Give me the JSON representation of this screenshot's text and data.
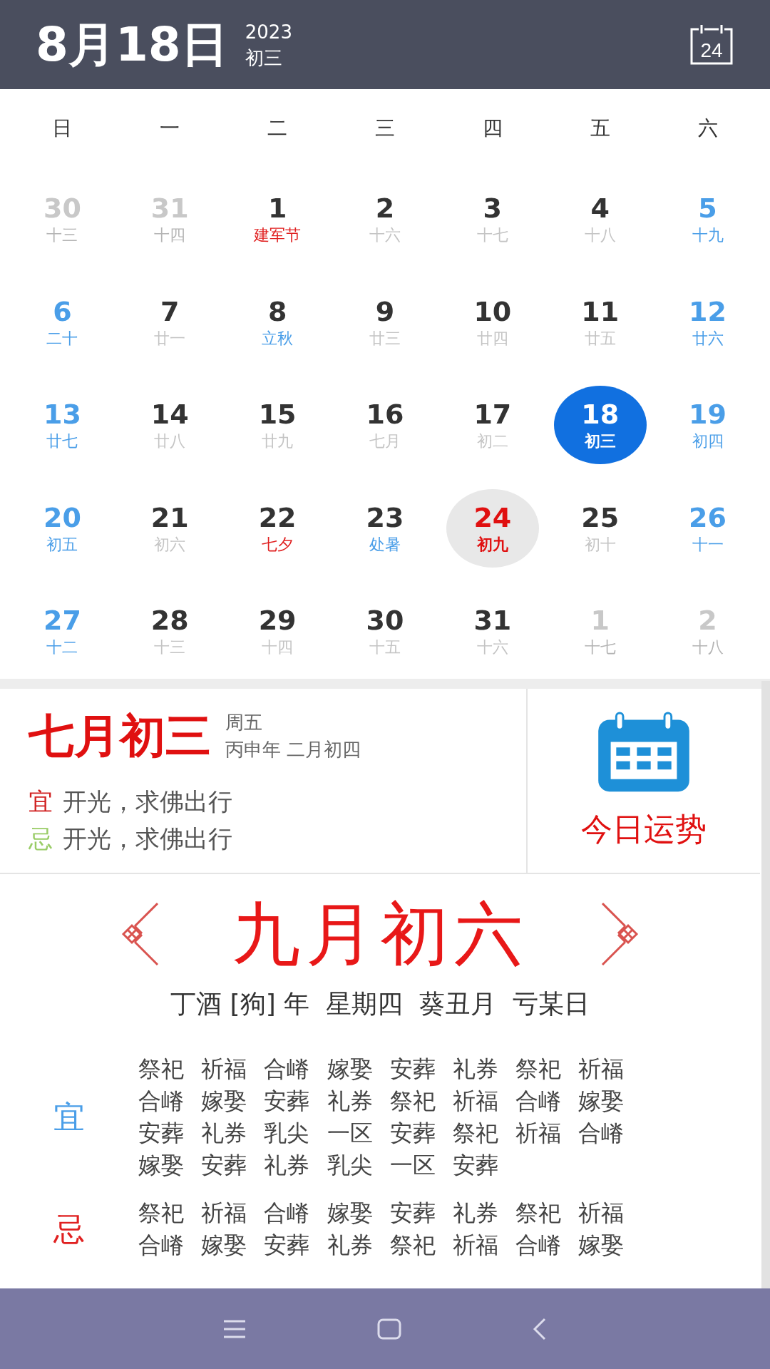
{
  "header": {
    "date": "8月18日",
    "year": "2023",
    "lunar": "初三",
    "today_button": "24"
  },
  "weekdays": [
    "日",
    "一",
    "二",
    "三",
    "四",
    "五",
    "六"
  ],
  "days": [
    {
      "day": "30",
      "lunar": {
        "text": "十三",
        "kind": "lunar"
      },
      "kind": "other",
      "selected": false,
      "today": false
    },
    {
      "day": "31",
      "lunar": {
        "text": "十四",
        "kind": "lunar"
      },
      "kind": "other",
      "selected": false,
      "today": false
    },
    {
      "day": "1",
      "lunar": {
        "text": "建军节",
        "kind": "festival"
      },
      "kind": "weekday",
      "selected": false,
      "today": false
    },
    {
      "day": "2",
      "lunar": {
        "text": "十六",
        "kind": "lunar"
      },
      "kind": "weekday",
      "selected": false,
      "today": false
    },
    {
      "day": "3",
      "lunar": {
        "text": "十七",
        "kind": "lunar"
      },
      "kind": "weekday",
      "selected": false,
      "today": false
    },
    {
      "day": "4",
      "lunar": {
        "text": "十八",
        "kind": "lunar"
      },
      "kind": "weekday",
      "selected": false,
      "today": false
    },
    {
      "day": "5",
      "lunar": {
        "text": "十九",
        "kind": "lunar"
      },
      "kind": "weekend",
      "selected": false,
      "today": false
    },
    {
      "day": "6",
      "lunar": {
        "text": "二十",
        "kind": "lunar"
      },
      "kind": "weekend",
      "selected": false,
      "today": false
    },
    {
      "day": "7",
      "lunar": {
        "text": "廿一",
        "kind": "lunar"
      },
      "kind": "weekday",
      "selected": false,
      "today": false
    },
    {
      "day": "8",
      "lunar": {
        "text": "立秋",
        "kind": "term"
      },
      "kind": "weekday",
      "selected": false,
      "today": false
    },
    {
      "day": "9",
      "lunar": {
        "text": "廿三",
        "kind": "lunar"
      },
      "kind": "weekday",
      "selected": false,
      "today": false
    },
    {
      "day": "10",
      "lunar": {
        "text": "廿四",
        "kind": "lunar"
      },
      "kind": "weekday",
      "selected": false,
      "today": false
    },
    {
      "day": "11",
      "lunar": {
        "text": "廿五",
        "kind": "lunar"
      },
      "kind": "weekday",
      "selected": false,
      "today": false
    },
    {
      "day": "12",
      "lunar": {
        "text": "廿六",
        "kind": "lunar"
      },
      "kind": "weekend",
      "selected": false,
      "today": false
    },
    {
      "day": "13",
      "lunar": {
        "text": "廿七",
        "kind": "lunar"
      },
      "kind": "weekend",
      "selected": false,
      "today": false
    },
    {
      "day": "14",
      "lunar": {
        "text": "廿八",
        "kind": "lunar"
      },
      "kind": "weekday",
      "selected": false,
      "today": false
    },
    {
      "day": "15",
      "lunar": {
        "text": "廿九",
        "kind": "lunar"
      },
      "kind": "weekday",
      "selected": false,
      "today": false
    },
    {
      "day": "16",
      "lunar": {
        "text": "七月",
        "kind": "lunar"
      },
      "kind": "weekday",
      "selected": false,
      "today": false
    },
    {
      "day": "17",
      "lunar": {
        "text": "初二",
        "kind": "lunar"
      },
      "kind": "weekday",
      "selected": false,
      "today": false
    },
    {
      "day": "18",
      "lunar": {
        "text": "初三",
        "kind": "lunar"
      },
      "kind": "weekday",
      "selected": true,
      "today": false
    },
    {
      "day": "19",
      "lunar": {
        "text": "初四",
        "kind": "lunar"
      },
      "kind": "weekend",
      "selected": false,
      "today": false
    },
    {
      "day": "20",
      "lunar": {
        "text": "初五",
        "kind": "lunar"
      },
      "kind": "weekend",
      "selected": false,
      "today": false
    },
    {
      "day": "21",
      "lunar": {
        "text": "初六",
        "kind": "lunar"
      },
      "kind": "weekday",
      "selected": false,
      "today": false
    },
    {
      "day": "22",
      "lunar": {
        "text": "七夕",
        "kind": "festival"
      },
      "kind": "weekday",
      "selected": false,
      "today": false
    },
    {
      "day": "23",
      "lunar": {
        "text": "处暑",
        "kind": "term"
      },
      "kind": "weekday",
      "selected": false,
      "today": false
    },
    {
      "day": "24",
      "lunar": {
        "text": "初九",
        "kind": "lunar"
      },
      "kind": "weekday",
      "selected": false,
      "today": true
    },
    {
      "day": "25",
      "lunar": {
        "text": "初十",
        "kind": "lunar"
      },
      "kind": "weekday",
      "selected": false,
      "today": false
    },
    {
      "day": "26",
      "lunar": {
        "text": "十一",
        "kind": "lunar"
      },
      "kind": "weekend",
      "selected": false,
      "today": false
    },
    {
      "day": "27",
      "lunar": {
        "text": "十二",
        "kind": "lunar"
      },
      "kind": "weekend",
      "selected": false,
      "today": false
    },
    {
      "day": "28",
      "lunar": {
        "text": "十三",
        "kind": "lunar"
      },
      "kind": "weekday",
      "selected": false,
      "today": false
    },
    {
      "day": "29",
      "lunar": {
        "text": "十四",
        "kind": "lunar"
      },
      "kind": "weekday",
      "selected": false,
      "today": false
    },
    {
      "day": "30",
      "lunar": {
        "text": "十五",
        "kind": "lunar"
      },
      "kind": "weekday",
      "selected": false,
      "today": false
    },
    {
      "day": "31",
      "lunar": {
        "text": "十六",
        "kind": "lunar"
      },
      "kind": "weekday",
      "selected": false,
      "today": false
    },
    {
      "day": "1",
      "lunar": {
        "text": "十七",
        "kind": "lunar"
      },
      "kind": "other",
      "selected": false,
      "today": false
    },
    {
      "day": "2",
      "lunar": {
        "text": "十八",
        "kind": "lunar"
      },
      "kind": "other",
      "selected": false,
      "today": false
    }
  ],
  "lunar_card": {
    "date": "七月初三",
    "weekday": "周五",
    "ganzhi": "丙申年 二月初四",
    "good_label": "宜",
    "good": "开光，求佛出行",
    "bad_label": "忌",
    "bad": "开光，求佛出行",
    "fortune_button": "今日运势"
  },
  "almanac": {
    "title": "九月初六",
    "subtitle": "丁酒 [狗] 年  星期四  葵丑月  亏某日",
    "sections": [
      {
        "label": "宜",
        "kind": "good",
        "lines": [
          "祭祀 祈福 合嵴 嫁娶 安葬 礼券 祭祀 祈福",
          "合嵴 嫁娶 安葬 礼券 祭祀 祈福 合嵴 嫁娶",
          "安葬 礼券 乳尖 一区 安葬 祭祀 祈福 合嵴",
          "嫁娶 安葬 礼券 乳尖 一区 安葬"
        ]
      },
      {
        "label": "忌",
        "kind": "bad",
        "lines": [
          "祭祀 祈福 合嵴 嫁娶 安葬 礼券 祭祀 祈福",
          "合嵴 嫁娶 安葬 礼券 祭祀 祈福 合嵴 嫁娶"
        ]
      }
    ]
  }
}
